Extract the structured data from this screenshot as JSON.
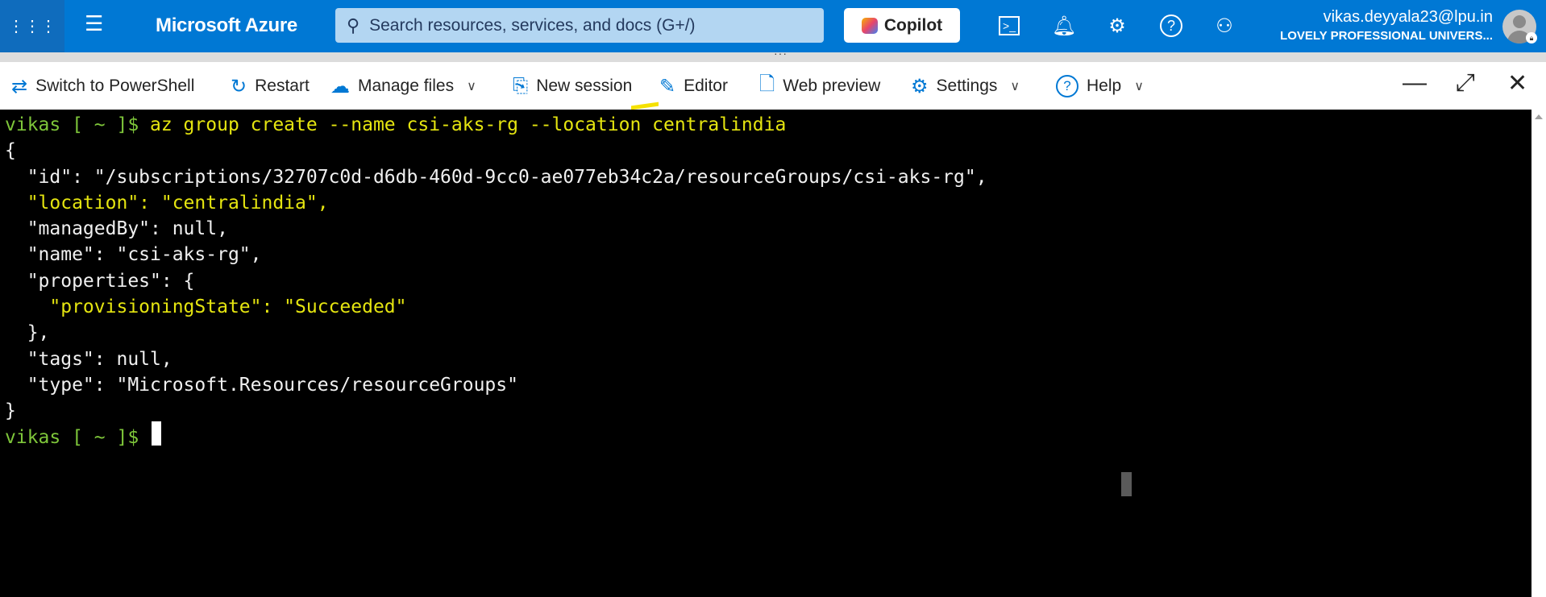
{
  "header": {
    "brand": "Microsoft Azure",
    "search_placeholder": "Search resources, services, and docs (G+/)",
    "copilot_label": "Copilot",
    "user_email": "vikas.deyyala23@lpu.in",
    "user_org": "LOVELY PROFESSIONAL UNIVERS...",
    "icons": [
      "waffle-icon",
      "menu-icon",
      "search-icon",
      "cloud-shell-icon",
      "bell-icon",
      "gear-icon",
      "help-icon",
      "feedback-icon"
    ]
  },
  "toolbar": {
    "switch": "Switch to PowerShell",
    "restart": "Restart",
    "manage_files": "Manage files",
    "new_session": "New session",
    "editor": "Editor",
    "web_preview": "Web preview",
    "settings": "Settings",
    "help": "Help"
  },
  "terminal": {
    "prompt": "vikas [ ~ ]$ ",
    "command": "az group create --name csi-aks-rg --location centralindia",
    "lines": [
      "{",
      "  \"id\": \"/subscriptions/32707c0d-d6db-460d-9cc0-ae077eb34c2a/resourceGroups/csi-aks-rg\",",
      "  \"location\": \"centralindia\",",
      "  \"managedBy\": null,",
      "  \"name\": \"csi-aks-rg\",",
      "  \"properties\": {",
      "    \"provisioningState\": \"Succeeded\"",
      "  },",
      "  \"tags\": null,",
      "  \"type\": \"Microsoft.Resources/resourceGroups\"",
      "}"
    ],
    "colors": {
      "prompt": "#7ec63a",
      "command": "#e5e510",
      "text": "#f0f0f0"
    }
  }
}
